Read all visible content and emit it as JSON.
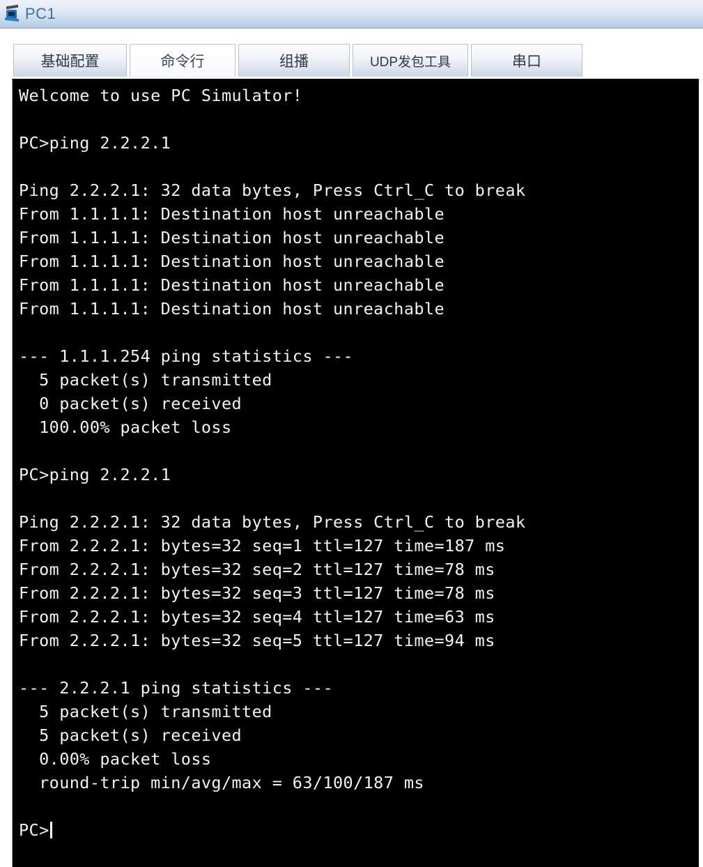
{
  "window": {
    "title": "PC1",
    "icon": "pc-device-icon",
    "title_color": "#3d6fa8"
  },
  "tabs": [
    {
      "id": "basic-config",
      "label": "基础配置",
      "active": false
    },
    {
      "id": "command-line",
      "label": "命令行",
      "active": true
    },
    {
      "id": "multicast",
      "label": "组播",
      "active": false
    },
    {
      "id": "udp-sender",
      "label": "UDP发包工具",
      "active": false
    },
    {
      "id": "serial-port",
      "label": "串口",
      "active": false
    }
  ],
  "terminal": {
    "background": "#000000",
    "foreground": "#f2f2f2",
    "prompt": "PC>",
    "cursor_visible": true,
    "lines": [
      "Welcome to use PC Simulator!",
      "",
      "PC>ping 2.2.2.1",
      "",
      "Ping 2.2.2.1: 32 data bytes, Press Ctrl_C to break",
      "From 1.1.1.1: Destination host unreachable",
      "From 1.1.1.1: Destination host unreachable",
      "From 1.1.1.1: Destination host unreachable",
      "From 1.1.1.1: Destination host unreachable",
      "From 1.1.1.1: Destination host unreachable",
      "",
      "--- 1.1.1.254 ping statistics ---",
      "  5 packet(s) transmitted",
      "  0 packet(s) received",
      "  100.00% packet loss",
      "",
      "PC>ping 2.2.2.1",
      "",
      "Ping 2.2.2.1: 32 data bytes, Press Ctrl_C to break",
      "From 2.2.2.1: bytes=32 seq=1 ttl=127 time=187 ms",
      "From 2.2.2.1: bytes=32 seq=2 ttl=127 time=78 ms",
      "From 2.2.2.1: bytes=32 seq=3 ttl=127 time=78 ms",
      "From 2.2.2.1: bytes=32 seq=4 ttl=127 time=63 ms",
      "From 2.2.2.1: bytes=32 seq=5 ttl=127 time=94 ms",
      "",
      "--- 2.2.2.1 ping statistics ---",
      "  5 packet(s) transmitted",
      "  5 packet(s) received",
      "  0.00% packet loss",
      "  round-trip min/avg/max = 63/100/187 ms",
      ""
    ]
  }
}
